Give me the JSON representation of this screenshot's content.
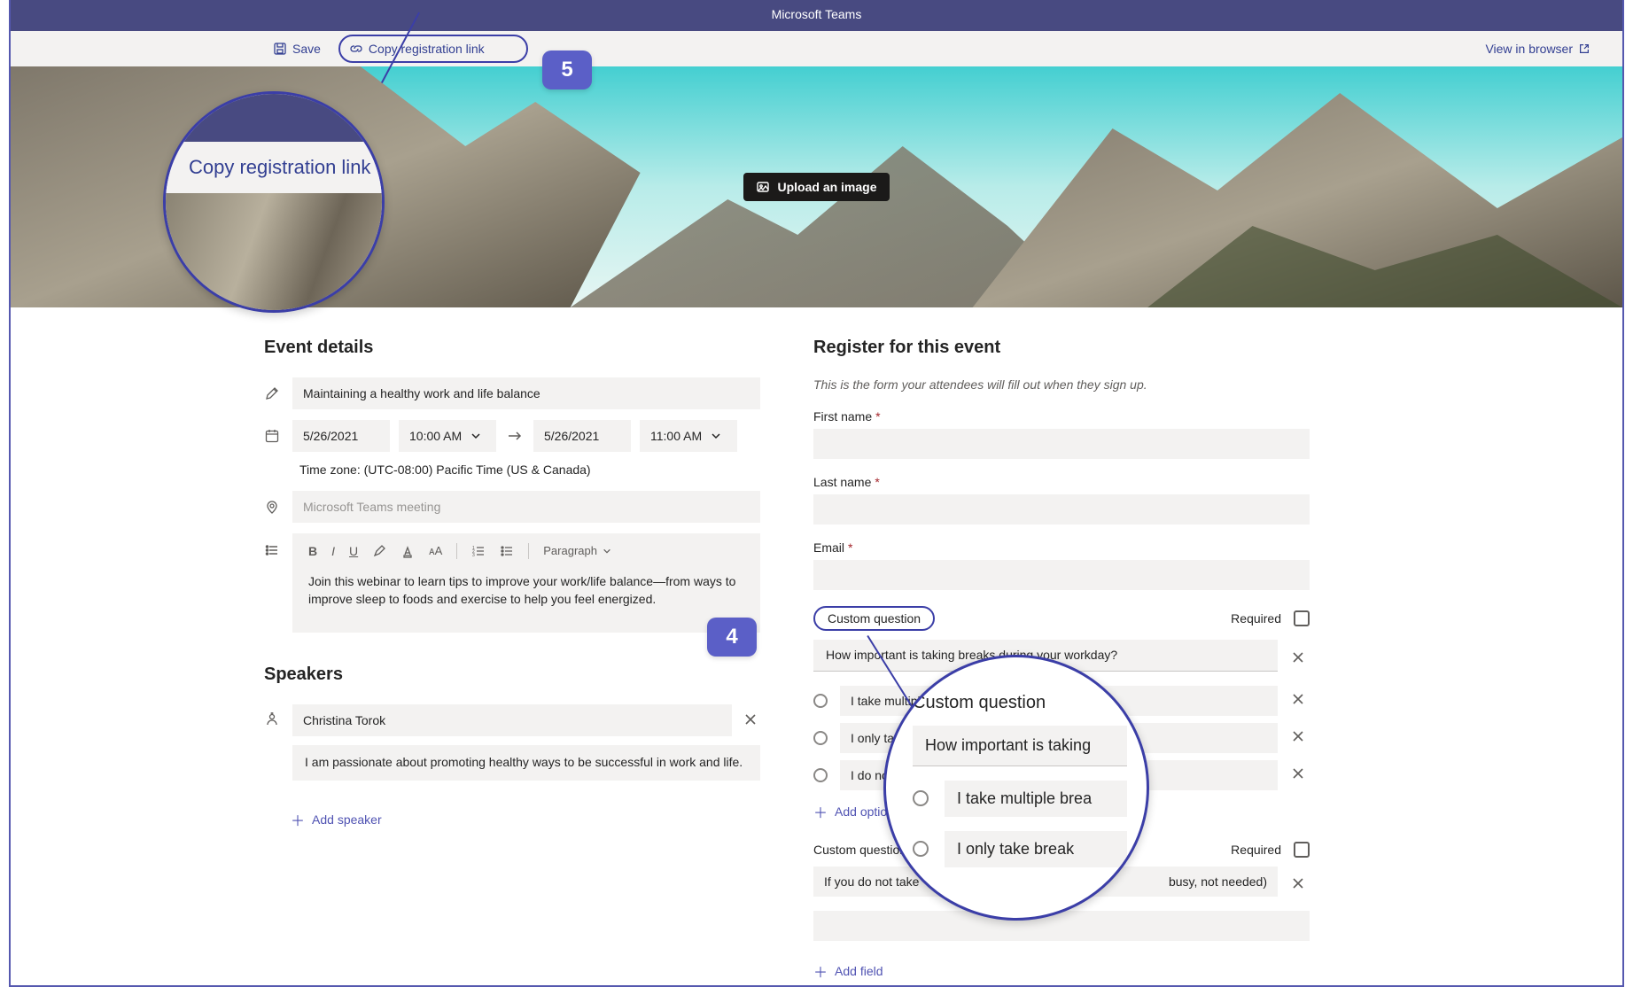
{
  "app_title": "Microsoft Teams",
  "toolbar": {
    "save": "Save",
    "copy_reg_link": "Copy registration link",
    "view_in_browser": "View in browser"
  },
  "steps": {
    "four": "4",
    "five": "5"
  },
  "magnifier1": {
    "copy_reg_link": "Copy registration link"
  },
  "banner": {
    "upload": "Upload an image"
  },
  "event": {
    "section_title": "Event details",
    "title": "Maintaining a healthy work and life balance",
    "start_date": "5/26/2021",
    "start_time": "10:00 AM",
    "end_date": "5/26/2021",
    "end_time": "11:00 AM",
    "timezone": "Time zone: (UTC-08:00) Pacific Time (US & Canada)",
    "location_placeholder": "Microsoft Teams meeting",
    "rtf": {
      "paragraph_btn": "Paragraph",
      "body": "Join this webinar to learn tips to improve your work/life balance—from ways to improve sleep to foods and exercise to help you feel energized."
    }
  },
  "speakers": {
    "section_title": "Speakers",
    "name": "Christina Torok",
    "bio": "I am passionate about promoting healthy ways to be successful in work and life.",
    "add_speaker": "Add speaker"
  },
  "register": {
    "section_title": "Register for this event",
    "hint": "This is the form your attendees will fill out when they sign up.",
    "first_name": "First name",
    "last_name": "Last name",
    "email": "Email",
    "custom_question_label": "Custom question",
    "required_label": "Required",
    "q1": {
      "text": "How important is taking breaks during your workday?",
      "opt1": "I take multiple breaks",
      "opt2": "I only take breaks",
      "opt3": "I do not take",
      "add_option": "Add option"
    },
    "q2": {
      "label": "Custom question",
      "text": "If you do not take",
      "suffix": "busy, not needed)"
    },
    "add_field": "Add field"
  },
  "magnifier2": {
    "title": "Custom question",
    "q": "How important is taking",
    "opt1": "I take multiple brea",
    "opt2": "I only take break"
  }
}
